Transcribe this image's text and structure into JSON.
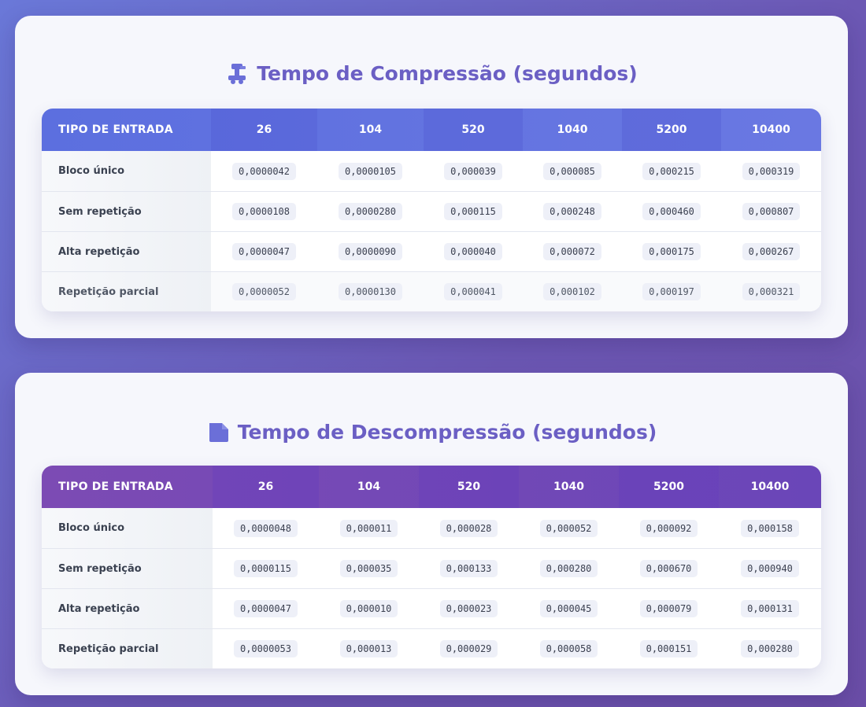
{
  "compression": {
    "title": "Tempo de Compressão (segundos)",
    "icon": "clamp-icon",
    "headers": [
      "TIPO DE ENTRADA",
      "26",
      "104",
      "520",
      "1040",
      "5200",
      "10400"
    ],
    "rows": [
      {
        "label": "Bloco único",
        "values": [
          "0,0000042",
          "0,0000105",
          "0,000039",
          "0,000085",
          "0,000215",
          "0,000319"
        ]
      },
      {
        "label": "Sem repetição",
        "values": [
          "0,0000108",
          "0,0000280",
          "0,000115",
          "0,000248",
          "0,000460",
          "0,000807"
        ]
      },
      {
        "label": "Alta repetição",
        "values": [
          "0,0000047",
          "0,0000090",
          "0,000040",
          "0,000072",
          "0,000175",
          "0,000267"
        ]
      },
      {
        "label": "Repetição parcial",
        "values": [
          "0,0000052",
          "0,0000130",
          "0,000041",
          "0,000102",
          "0,000197",
          "0,000321"
        ]
      }
    ]
  },
  "decompression": {
    "title": "Tempo de Descompressão (segundos)",
    "icon": "folder-shape-icon",
    "headers": [
      "TIPO DE ENTRADA",
      "26",
      "104",
      "520",
      "1040",
      "5200",
      "10400"
    ],
    "rows": [
      {
        "label": "Bloco único",
        "values": [
          "0,0000048",
          "0,000011",
          "0,000028",
          "0,000052",
          "0,000092",
          "0,000158"
        ]
      },
      {
        "label": "Sem repetição",
        "values": [
          "0,0000115",
          "0,000035",
          "0,000133",
          "0,000280",
          "0,000670",
          "0,000940"
        ]
      },
      {
        "label": "Alta repetição",
        "values": [
          "0,0000047",
          "0,000010",
          "0,000023",
          "0,000045",
          "0,000079",
          "0,000131"
        ]
      },
      {
        "label": "Repetição parcial",
        "values": [
          "0,0000053",
          "0,000013",
          "0,000029",
          "0,000058",
          "0,000151",
          "0,000280"
        ]
      }
    ]
  },
  "colors": {
    "title": "#6b5fc4",
    "compression_header": "#5c6fdf",
    "decompression_header": "#7c4bb4"
  }
}
